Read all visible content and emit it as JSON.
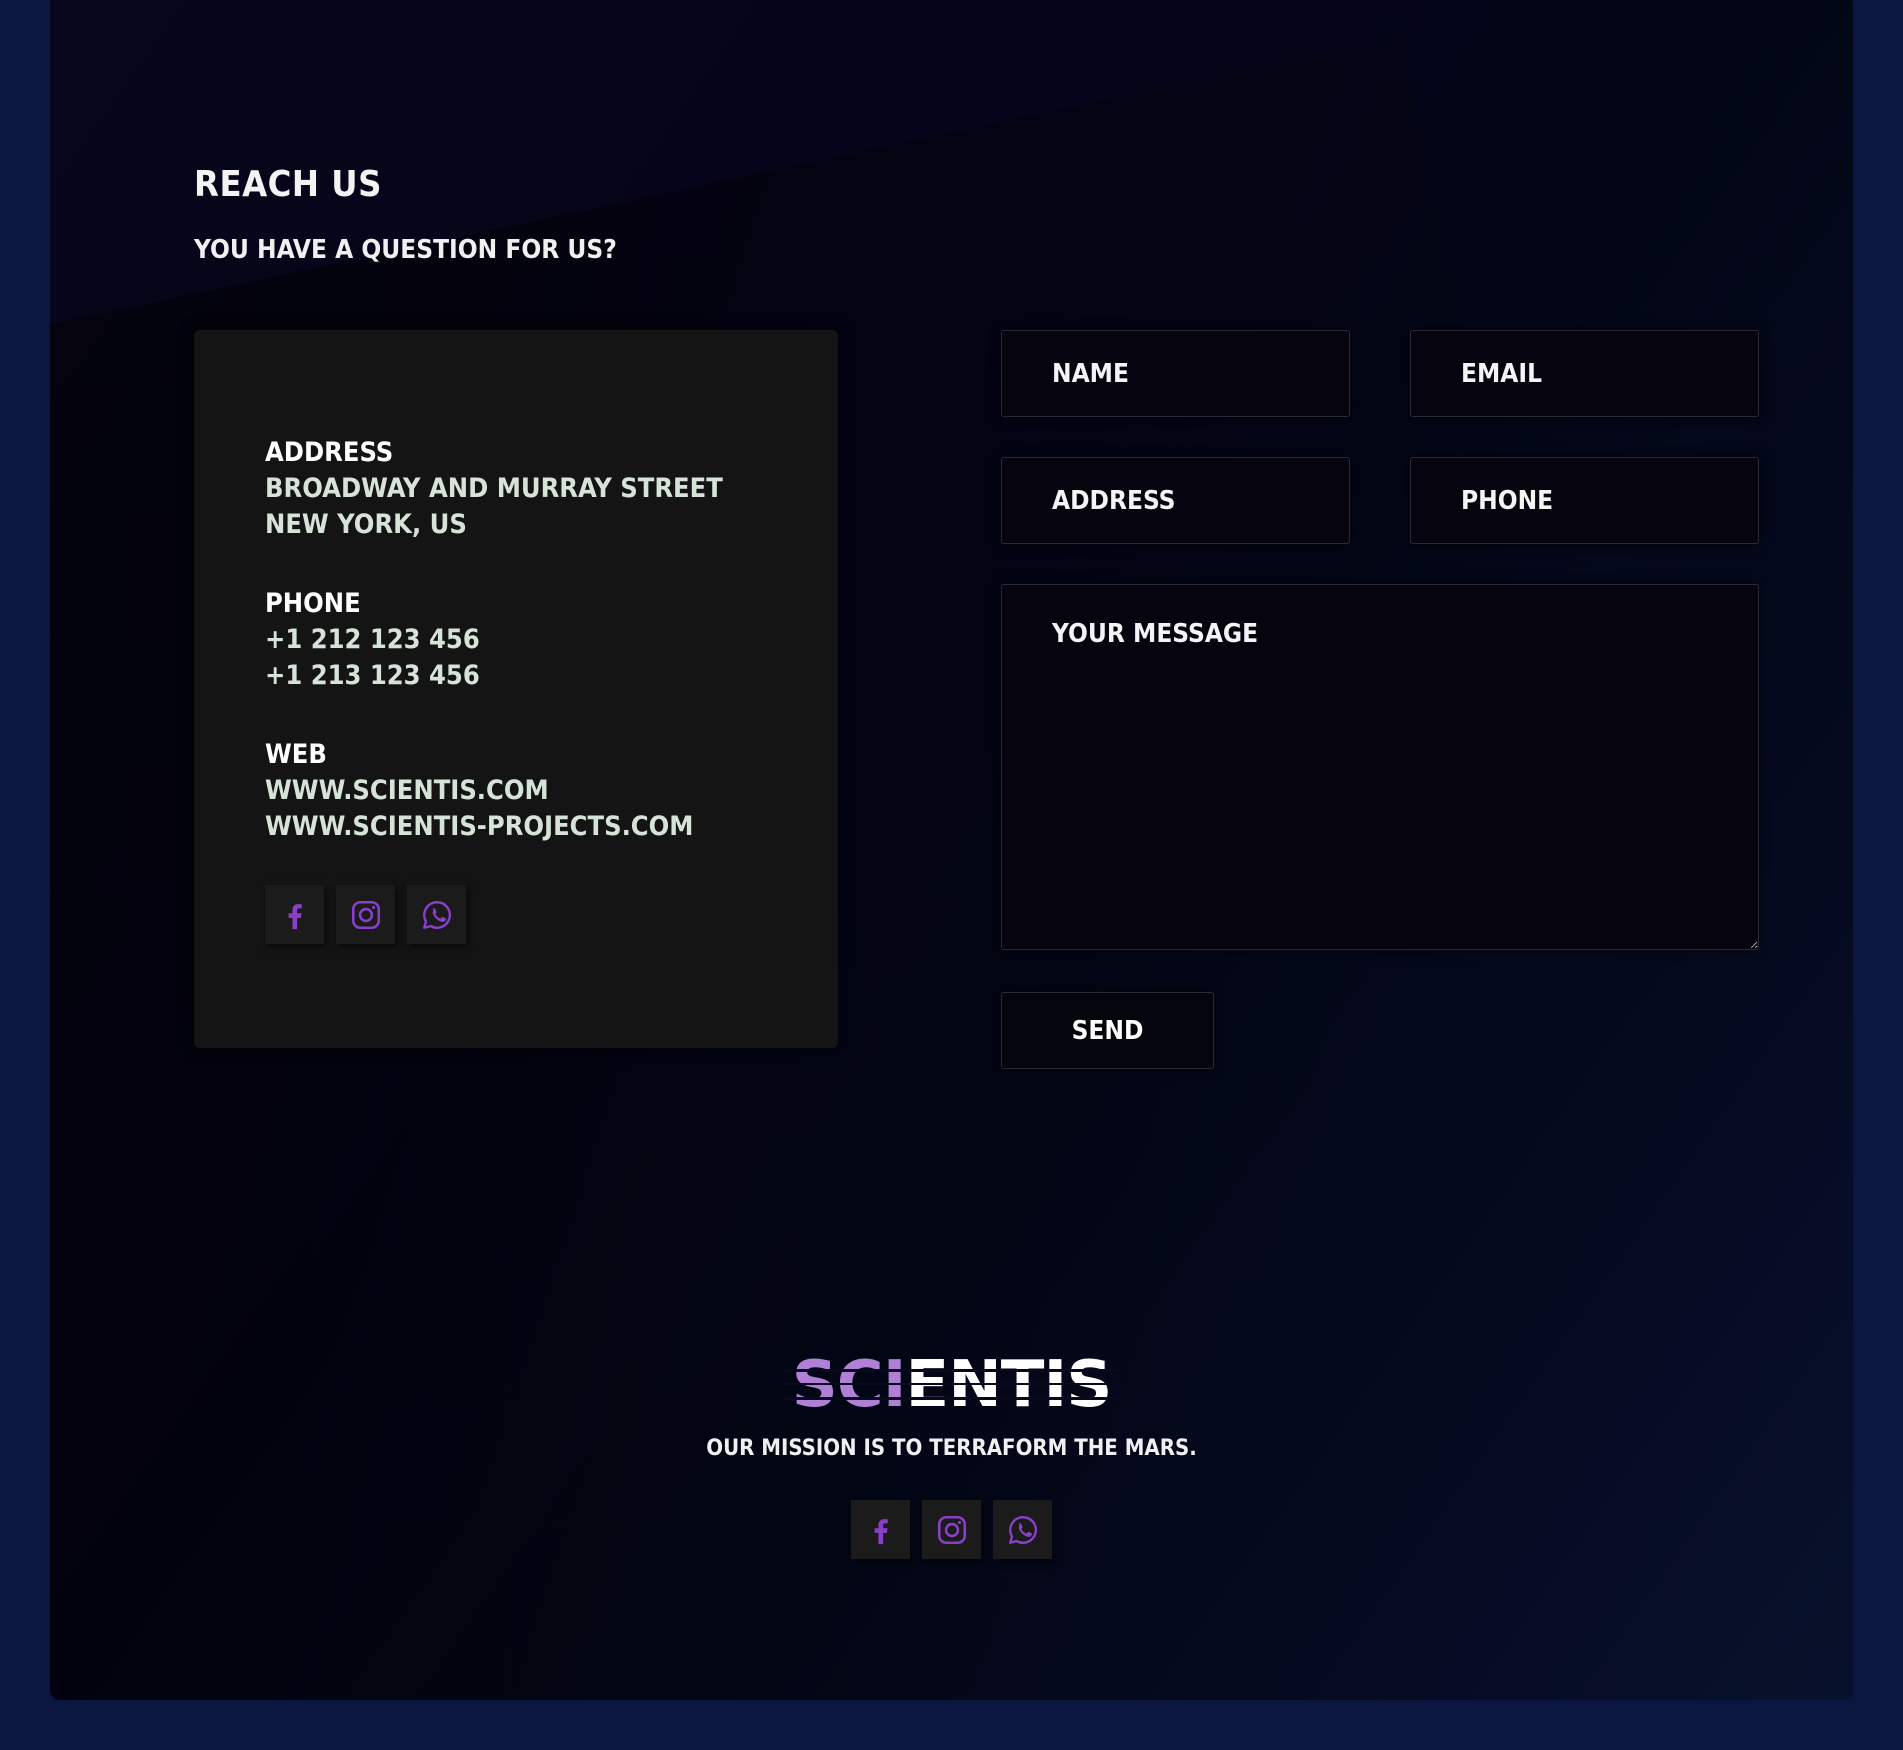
{
  "contact": {
    "title": "Reach us",
    "subtitle": "You have a question for us?",
    "address": {
      "label": "Address",
      "lines": [
        "Broadway and Murray Street",
        "New York, US"
      ]
    },
    "phone": {
      "label": "Phone",
      "lines": [
        "+1 212 123 456",
        "+1 213 123 456"
      ]
    },
    "web": {
      "label": "Web",
      "lines": [
        "www.scientis.com",
        "www.scientis-projects.com"
      ]
    },
    "social": [
      "facebook-icon",
      "instagram-icon",
      "whatsapp-icon"
    ]
  },
  "form": {
    "name_placeholder": "Name",
    "email_placeholder": "Email",
    "address_placeholder": "Address",
    "phone_placeholder": "Phone",
    "message_placeholder": "Your message",
    "send_label": "Send"
  },
  "footer": {
    "logo_part1": "SCI",
    "logo_part2": "ENTIS",
    "tagline": "Our mission is to terraform the Mars.",
    "social": [
      "facebook-icon",
      "instagram-icon",
      "whatsapp-icon"
    ]
  },
  "colors": {
    "page_background": "#0b1640",
    "panel_background": "#05041a",
    "card_background": "#141414",
    "icon_accent": "#8a3fc8",
    "logo_accent": "#b07fd6",
    "text_muted": "#d6e4d8"
  }
}
